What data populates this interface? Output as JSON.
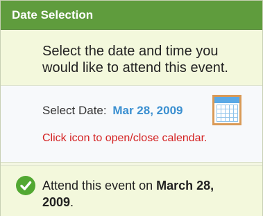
{
  "header": {
    "title": "Date Selection"
  },
  "intro": {
    "text": "Select the date and time you would like to attend this event."
  },
  "date_select": {
    "label": "Select Date:",
    "value": "Mar 28, 2009",
    "icon": "calendar-icon",
    "hint": "Click icon to open/close calendar.",
    "value_color": "#3a8fd0",
    "hint_color": "#d42121"
  },
  "confirmation": {
    "icon": "checkmark-icon",
    "prefix": "Attend this event on",
    "date": "March 28, 2009",
    "suffix": ".",
    "icon_color": "#52a832"
  },
  "colors": {
    "header_bg": "#5f9c3d",
    "panel_bg": "#f3f8dc"
  }
}
